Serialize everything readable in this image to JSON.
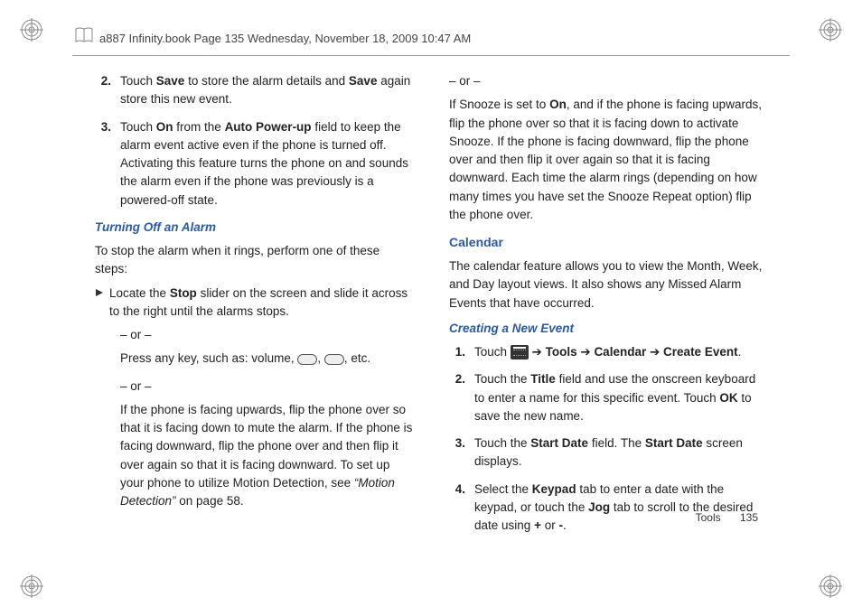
{
  "header": "a887 Infinity.book  Page 135  Wednesday, November 18, 2009  10:47 AM",
  "left": {
    "step2_pre": "Touch ",
    "step2_b1": "Save",
    "step2_mid": " to store the alarm details and ",
    "step2_b2": "Save",
    "step2_post": " again store this new event.",
    "step3_pre": "Touch ",
    "step3_b1": "On",
    "step3_mid1": " from the ",
    "step3_b2": "Auto Power-up",
    "step3_post": " field to keep the alarm event active even if the phone is turned off. Activating this feature turns the phone on and sounds the alarm even if the phone was previously is a powered-off state.",
    "sub1": "Turning Off an Alarm",
    "intro": "To stop the alarm when it rings, perform one of these steps:",
    "locate_pre": "Locate the ",
    "locate_b": "Stop",
    "locate_post": " slider on the screen and slide it across to the right until the alarms stops.",
    "or": "– or –",
    "press_pre": "Press any key, such as: volume, ",
    "press_post": ", etc.",
    "flip_pre": "If the phone is facing upwards, flip the phone over so that it is facing down to mute the alarm. If the phone is facing downward, flip the phone over and then flip it over again so that it is facing downward. To set up your phone to utilize Motion Detection, see ",
    "flip_ref": "“Motion Detection”",
    "flip_post": " on page 58."
  },
  "right": {
    "or": "– or –",
    "snooze_pre": "If Snooze is set to ",
    "snooze_b": "On",
    "snooze_post": ", and if the phone is facing upwards, flip the phone over so that it is facing down to activate Snooze. If the phone is facing downward, flip the phone over and then flip it over again so that it is facing downward. Each time the alarm rings (depending on how many times you have set the Snooze Repeat option) flip the phone over.",
    "cal_head": "Calendar",
    "cal_body": "The calendar feature allows you to view the Month, Week, and Day layout views. It also shows any Missed Alarm Events that have occurred.",
    "sub2": "Creating a New Event",
    "s1_pre": "Touch ",
    "s1_arr": " ➔ ",
    "s1_b1": "Tools",
    "s1_b2": "Calendar",
    "s1_b3": "Create Event",
    "s1_dot": ".",
    "s2_pre": "Touch the ",
    "s2_b1": "Title",
    "s2_mid": " field and use the onscreen keyboard to enter a name for this specific event. Touch ",
    "s2_b2": "OK",
    "s2_post": " to save the new name.",
    "s3_pre": "Touch the ",
    "s3_b1": "Start Date",
    "s3_mid": " field. The ",
    "s3_b2": "Start Date",
    "s3_post": " screen displays.",
    "s4_pre": "Select the ",
    "s4_b1": "Keypad",
    "s4_mid": " tab to enter a date with the keypad, or touch the ",
    "s4_b2": "Jog",
    "s4_mid2": " tab to scroll to the desired date using ",
    "s4_b3": "+",
    "s4_or": " or ",
    "s4_b4": "-",
    "s4_dot": "."
  },
  "nums": {
    "n2": "2.",
    "n3": "3.",
    "r1": "1.",
    "r2": "2.",
    "r3": "3.",
    "r4": "4."
  },
  "footer": {
    "section": "Tools",
    "page": "135"
  },
  "comma": ", "
}
